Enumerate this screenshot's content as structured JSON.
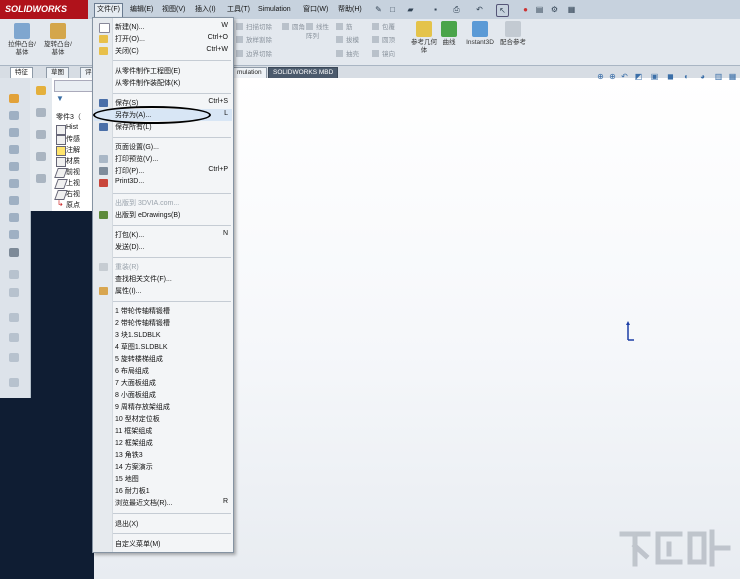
{
  "app": {
    "logo_text": "SOLIDWORKS"
  },
  "menubar": {
    "items": [
      {
        "label": "文件(F)"
      },
      {
        "label": "编辑(E)"
      },
      {
        "label": "视图(V)"
      },
      {
        "label": "插入(I)"
      },
      {
        "label": "工具(T)"
      },
      {
        "label": "Simulation"
      },
      {
        "label": "窗口(W)"
      },
      {
        "label": "帮助(H)"
      }
    ]
  },
  "ribbon": {
    "left_buttons": [
      {
        "label": "拉伸凸台/基体"
      },
      {
        "label": "旋转凸台/基体"
      }
    ],
    "small_items": [
      "扫描切除",
      "放样割除",
      "边界切除",
      "圆角",
      "线性阵列",
      "筋",
      "拔模",
      "抽壳",
      "包覆",
      "圆顶",
      "镜向",
      "相交"
    ],
    "right_buttons": [
      {
        "label": "参考几何体"
      },
      {
        "label": "曲线"
      },
      {
        "label": "Instant3D"
      },
      {
        "label": "配合参考"
      }
    ]
  },
  "tabs": [
    {
      "label": "特征"
    },
    {
      "label": "草图"
    },
    {
      "label": "评"
    },
    {
      "label": "mulation"
    },
    {
      "label": "SOLIDWORKS MBD"
    }
  ],
  "tree": {
    "root": "零件3（",
    "items": [
      "Hist",
      "传感",
      "注解",
      "材质",
      "前视",
      "上视",
      "右视",
      "原点"
    ]
  },
  "file_menu": {
    "items": [
      {
        "label": "新建(N)...",
        "shortcut": "W"
      },
      {
        "label": "打开(O)...",
        "shortcut": "Ctrl+O"
      },
      {
        "label": "关闭(C)",
        "shortcut": "Ctrl+W"
      },
      {
        "label": "从零件制作工程图(E)",
        "shortcut": ""
      },
      {
        "label": "从零件制作装配体(K)",
        "shortcut": ""
      },
      {
        "label": "保存(S)",
        "shortcut": "Ctrl+S"
      },
      {
        "label": "另存为(A)...",
        "shortcut": "L"
      },
      {
        "label": "保存所有(L)",
        "shortcut": ""
      },
      {
        "label": "页面设置(G)...",
        "shortcut": ""
      },
      {
        "label": "打印预览(V)...",
        "shortcut": ""
      },
      {
        "label": "打印(P)...",
        "shortcut": "Ctrl+P"
      },
      {
        "label": "Print3D...",
        "shortcut": ""
      },
      {
        "label": "出版到 3DVIA.com...",
        "shortcut": ""
      },
      {
        "label": "出版到 eDrawings(B)",
        "shortcut": ""
      },
      {
        "label": "打包(K)...",
        "shortcut": "N"
      },
      {
        "label": "发送(D)...",
        "shortcut": ""
      },
      {
        "label": "重装(R)",
        "shortcut": ""
      },
      {
        "label": "查找相关文件(F)...",
        "shortcut": ""
      },
      {
        "label": "属性(I)...",
        "shortcut": ""
      },
      {
        "label": "1 带轮传轴精锻槽",
        "shortcut": ""
      },
      {
        "label": "2 带轮传轴精锻槽",
        "shortcut": ""
      },
      {
        "label": "3 块1.SLDBLK",
        "shortcut": ""
      },
      {
        "label": "4 草图1.SLDBLK",
        "shortcut": ""
      },
      {
        "label": "5 旋转楼梯组成",
        "shortcut": ""
      },
      {
        "label": "6 布局组成",
        "shortcut": ""
      },
      {
        "label": "7 大面板组成",
        "shortcut": ""
      },
      {
        "label": "8 小面板组成",
        "shortcut": ""
      },
      {
        "label": "9 周精存放架组成",
        "shortcut": ""
      },
      {
        "label": "10 型材定位板",
        "shortcut": ""
      },
      {
        "label": "11 框架组成",
        "shortcut": ""
      },
      {
        "label": "12 框架组成",
        "shortcut": ""
      },
      {
        "label": "13 角铁3",
        "shortcut": ""
      },
      {
        "label": "14 方案演示",
        "shortcut": ""
      },
      {
        "label": "15 地图",
        "shortcut": ""
      },
      {
        "label": "16 耐力板1",
        "shortcut": ""
      },
      {
        "label": "浏览最近文档(R)...",
        "shortcut": "R"
      },
      {
        "label": "退出(X)",
        "shortcut": ""
      },
      {
        "label": "自定义菜单(M)",
        "shortcut": ""
      }
    ]
  },
  "colors": {
    "accent": "#b0121b",
    "highlight_oval": "#000000",
    "menu_bg": "#f3f5f7"
  }
}
